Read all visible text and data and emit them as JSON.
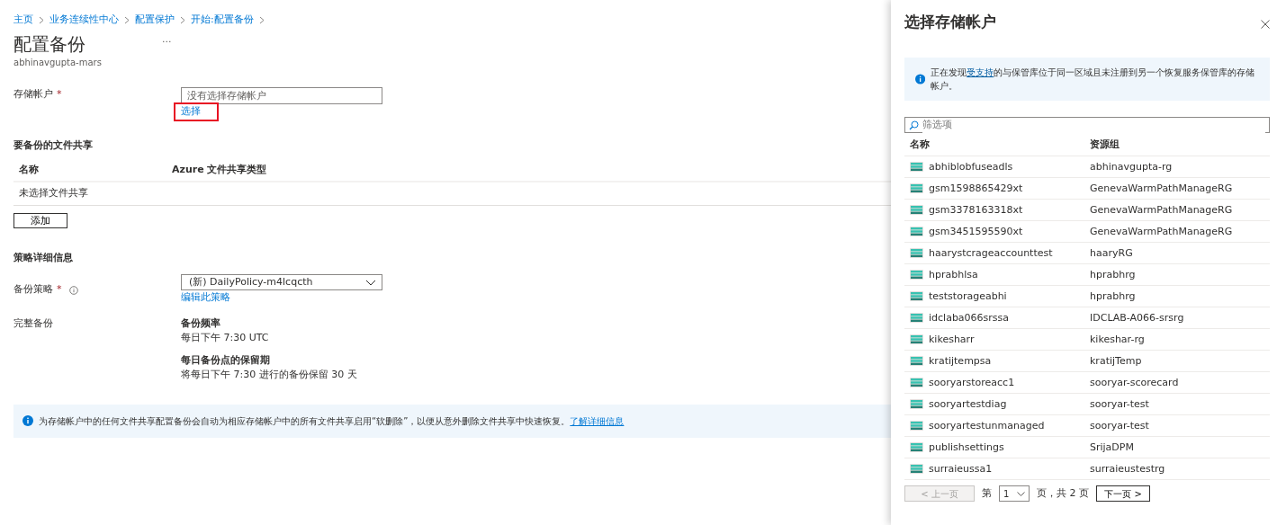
{
  "breadcrumbs": [
    "主页",
    "业务连续性中心",
    "配置保护",
    "开始:配置备份"
  ],
  "page": {
    "title": "配置备份",
    "more": "...",
    "subtitle": "abhinavgupta-mars"
  },
  "storage_account": {
    "label": "存储帐户",
    "required": "*",
    "placeholder": "没有选择存储帐户",
    "link": "选择",
    "highlighted": true
  },
  "file_shares": {
    "heading": "要备份的文件共享",
    "columns": [
      "名称",
      "Azure 文件共享类型"
    ],
    "empty_row": "未选择文件共享",
    "add_button": "添加"
  },
  "policy": {
    "heading": "策略详细信息",
    "label": "备份策略",
    "required": "*",
    "value": "(新) DailyPolicy-m4lcqcth",
    "edit_link": "编辑此策略",
    "full_backup_label": "完整备份",
    "details": [
      {
        "title": "备份频率",
        "text": "每日下午 7:30 UTC"
      },
      {
        "title": "每日备份点的保留期",
        "text": "将每日下午 7:30 进行的备份保留 30 天"
      }
    ]
  },
  "info_bar": {
    "text": "为存储帐户中的任何文件共享配置备份会自动为相应存储帐户中的所有文件共享启用“软删除”，以便从意外删除文件共享中快速恢复。",
    "link": "了解详细信息"
  },
  "panel": {
    "title": "选择存储帐户",
    "notice": {
      "before": "正在发现",
      "link": "受支持",
      "after": "的与保管库位于同一区域且未注册到另一个恢复服务保管库的存储帐户。"
    },
    "filter_placeholder": "筛选项",
    "columns": [
      "名称",
      "资源组"
    ],
    "rows": [
      {
        "name": "abhiblobfuseadls",
        "group": "abhinavgupta-rg"
      },
      {
        "name": "gsm1598865429xt",
        "group": "GenevaWarmPathManageRG"
      },
      {
        "name": "gsm3378163318xt",
        "group": "GenevaWarmPathManageRG"
      },
      {
        "name": "gsm3451595590xt",
        "group": "GenevaWarmPathManageRG"
      },
      {
        "name": "haarystcrageaccounttest",
        "group": "haaryRG"
      },
      {
        "name": "hprabhlsa",
        "group": "hprabhrg"
      },
      {
        "name": "teststorageabhi",
        "group": "hprabhrg"
      },
      {
        "name": "idclaba066srssa",
        "group": "IDCLAB-A066-srsrg"
      },
      {
        "name": "kikesharr",
        "group": "kikeshar-rg"
      },
      {
        "name": "kratijtempsa",
        "group": "kratijTemp"
      },
      {
        "name": "sooryarstoreacc1",
        "group": "sooryar-scorecard"
      },
      {
        "name": "sooryartestdiag",
        "group": "sooryar-test"
      },
      {
        "name": "sooryartestunmanaged",
        "group": "sooryar-test"
      },
      {
        "name": "publishsettings",
        "group": "SrijaDPM"
      },
      {
        "name": "surraieussa1",
        "group": "surraieustestrg"
      }
    ],
    "pager": {
      "prev": {
        "label": "< 上一页",
        "disabled": true
      },
      "page_prefix": "第",
      "page": "1",
      "page_suffix": "页，共 2 页",
      "next": {
        "label": "下一页 >",
        "disabled": false
      }
    }
  }
}
